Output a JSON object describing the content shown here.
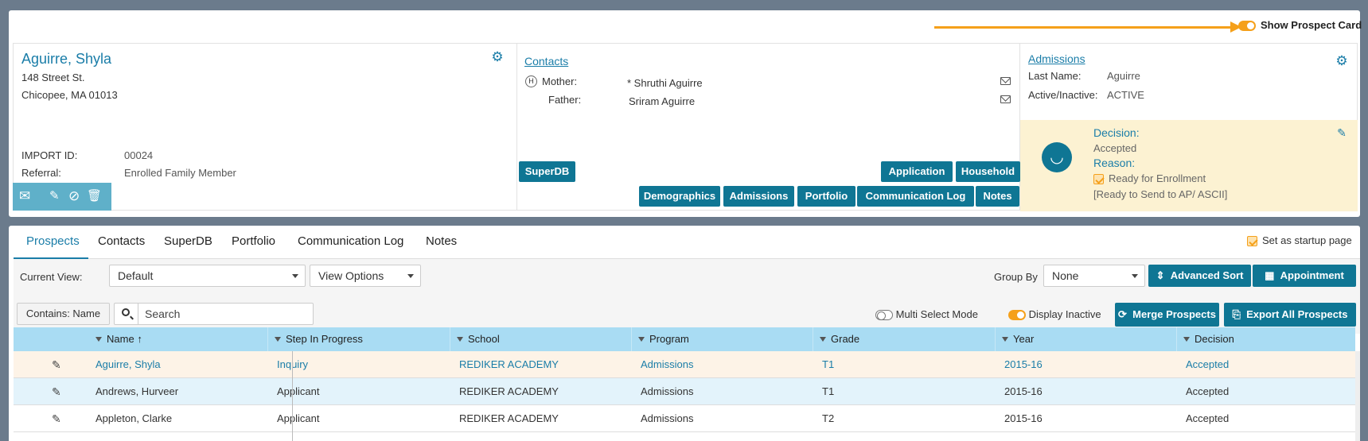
{
  "header": {
    "show_card_label": "Show Prospect Card",
    "show_card_on": true
  },
  "prospect": {
    "name": "Aguirre, Shyla",
    "address1": "148 Street St.",
    "address2": "Chicopee, MA 01013",
    "import_id_label": "IMPORT ID:",
    "import_id": "00024",
    "referral_label": "Referral:",
    "referral": "Enrolled Family Member"
  },
  "contacts": {
    "title": "Contacts",
    "household_badge": "H",
    "mother_label": "Mother:",
    "mother_name": "* Shruthi Aguirre",
    "father_label": "Father:",
    "father_name": "Sriram Aguirre",
    "superdb_btn": "SuperDB",
    "application_btn": "Application",
    "household_btn": "Household"
  },
  "admissions": {
    "title": "Admissions",
    "last_name_label": "Last Name:",
    "last_name": "Aguirre",
    "active_label": "Active/Inactive:",
    "active": "ACTIVE",
    "decision_label": "Decision:",
    "decision": "Accepted",
    "reason_label": "Reason:",
    "reason": "Ready for Enrollment",
    "reason_note": "[Ready to Send to AP/ ASCII]"
  },
  "card_buttons": [
    "Demographics",
    "Admissions",
    "Portfolio",
    "Communication Log",
    "Notes"
  ],
  "tabs": [
    "Prospects",
    "Contacts",
    "SuperDB",
    "Portfolio",
    "Communication Log",
    "Notes"
  ],
  "startup_label": "Set as startup page",
  "toolbar": {
    "current_view_label": "Current View:",
    "current_view": "Default",
    "view_options": "View Options",
    "group_by_label": "Group By",
    "group_by": "None",
    "advanced_sort": "Advanced Sort",
    "appointment": "Appointment",
    "contains": "Contains: Name",
    "search_placeholder": "Search",
    "multi_select": "Multi Select Mode",
    "display_inactive": "Display Inactive",
    "merge": "Merge Prospects",
    "export": "Export All Prospects"
  },
  "grid": {
    "columns": [
      "Name",
      "Step In Progress",
      "School",
      "Program",
      "Grade",
      "Year",
      "Decision"
    ],
    "sort_indicator": "↑",
    "rows": [
      {
        "name": "Aguirre, Shyla",
        "step": "Inquiry",
        "school": "REDIKER ACADEMY",
        "program": "Admissions",
        "grade": "T1",
        "year": "2015-16",
        "decision": "Accepted"
      },
      {
        "name": "Andrews, Hurveer",
        "step": "Applicant",
        "school": "REDIKER ACADEMY",
        "program": "Admissions",
        "grade": "T1",
        "year": "2015-16",
        "decision": "Accepted"
      },
      {
        "name": "Appleton, Clarke",
        "step": "Applicant",
        "school": "REDIKER ACADEMY",
        "program": "Admissions",
        "grade": "T2",
        "year": "2015-16",
        "decision": "Accepted"
      }
    ]
  },
  "colors": {
    "accent": "#0f7694",
    "link": "#1a7da8",
    "orange": "#f5a01a",
    "header_blue": "#a9dcf3",
    "selected_row": "#fdf3e7",
    "alt_row": "#e3f3fb"
  }
}
